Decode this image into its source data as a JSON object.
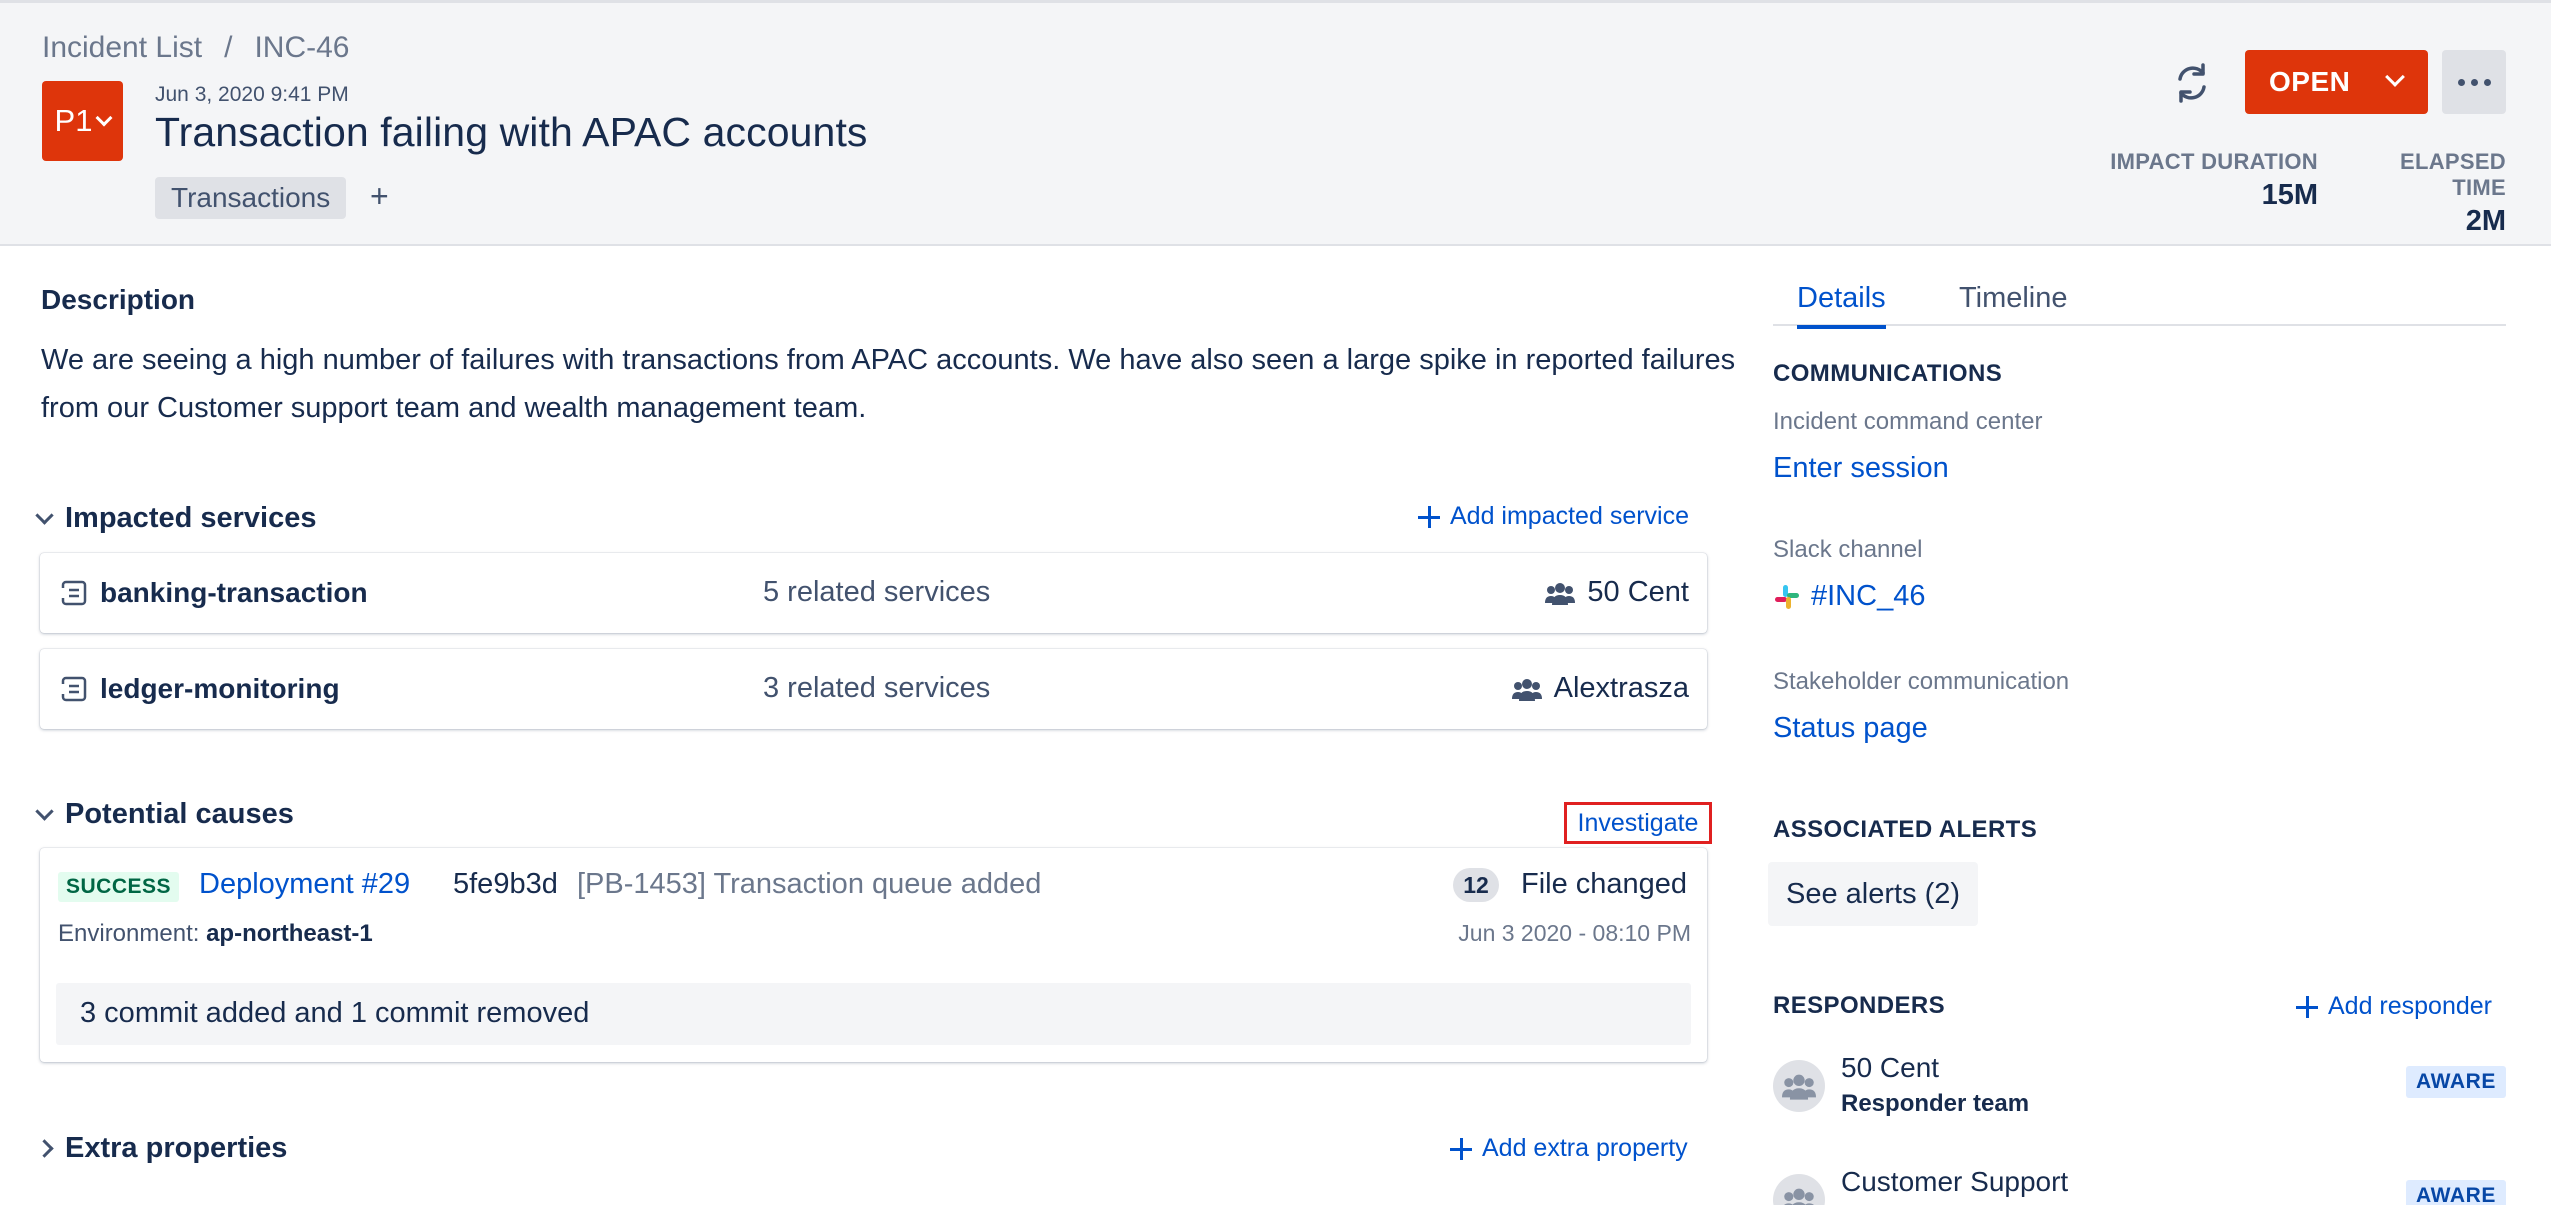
{
  "breadcrumb": {
    "parent": "Incident List",
    "separator": "/",
    "current": "INC-46"
  },
  "incident": {
    "priority": "P1",
    "created": "Jun 3, 2020 9:41 PM",
    "title": "Transaction failing with APAC accounts",
    "tags": [
      "Transactions"
    ],
    "add_tag": "+",
    "status": "OPEN"
  },
  "stats": {
    "impact_label": "IMPACT DURATION",
    "impact_value": "15M",
    "elapsed_label": "ELAPSED TIME",
    "elapsed_value": "2M"
  },
  "description": {
    "heading": "Description",
    "text": "We are seeing a high number of failures with transactions from APAC accounts. We have also seen a large spike in reported failures from our Customer support team and wealth management team."
  },
  "impacted": {
    "heading": "Impacted services",
    "add_label": "Add impacted service",
    "services": [
      {
        "name": "banking-transaction",
        "related": "5 related services",
        "owner": "50 Cent"
      },
      {
        "name": "ledger-monitoring",
        "related": "3 related services",
        "owner": "Alextrasza"
      }
    ]
  },
  "causes": {
    "heading": "Potential causes",
    "investigate_label": "Investigate",
    "item": {
      "status": "SUCCESS",
      "deployment": "Deployment #29",
      "hash": "5fe9b3d",
      "message": "[PB-1453] Transaction queue added",
      "files_count": "12",
      "files_label": "File changed",
      "env_label": "Environment:",
      "env_value": "ap-northeast-1",
      "date": "Jun 3 2020 - 08:10 PM",
      "commits": "3 commit added and 1 commit removed"
    }
  },
  "extra": {
    "heading": "Extra properties",
    "add_label": "Add extra property"
  },
  "tabs": [
    "Details",
    "Timeline"
  ],
  "communications": {
    "heading": "COMMUNICATIONS",
    "icc_label": "Incident command center",
    "icc_link": "Enter session",
    "slack_label": "Slack channel",
    "slack_link": "#INC_46",
    "stakeholder_label": "Stakeholder communication",
    "stakeholder_link": "Status page"
  },
  "alerts": {
    "heading": "ASSOCIATED ALERTS",
    "button": "See alerts (2)"
  },
  "responders": {
    "heading": "RESPONDERS",
    "add_label": "Add responder",
    "items": [
      {
        "name": "50 Cent",
        "sub": "Responder team",
        "status": "AWARE"
      },
      {
        "name": "Customer Support",
        "sub": "",
        "status": "AWARE"
      }
    ]
  },
  "colors": {
    "accent": "#0052cc",
    "danger": "#de350b",
    "success_bg": "#e3fcef",
    "success_fg": "#006644"
  }
}
